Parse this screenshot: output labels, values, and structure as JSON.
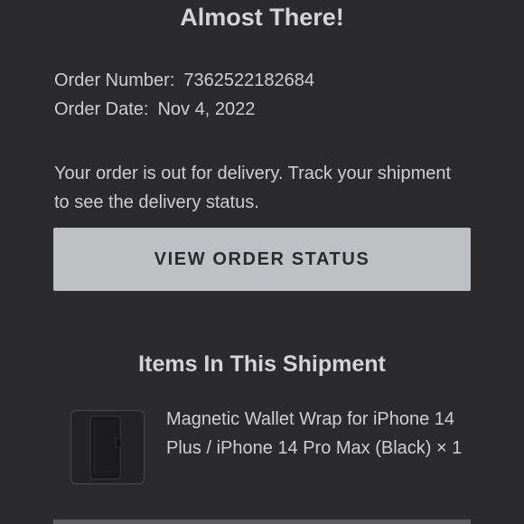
{
  "header": {
    "title": "Almost There!"
  },
  "order": {
    "number_label": "Order Number:",
    "number_value": "7362522182684",
    "date_label": "Order Date:",
    "date_value": "Nov 4, 2022"
  },
  "message": "Your order is out for delivery. Track your shipment to see the delivery status.",
  "actions": {
    "view_status_label": "VIEW ORDER STATUS"
  },
  "shipment": {
    "heading": "Items In This Shipment",
    "items": [
      {
        "description": "Magnetic Wallet Wrap for iPhone 14 Plus / iPhone 14 Pro Max (Black) × 1",
        "image_icon": "phone-wallet-case-icon"
      }
    ]
  },
  "colors": {
    "background": "#2b2b2e",
    "button": "#bfc0c3",
    "button_text": "#2a2a2c",
    "text": "#cfcfd1"
  }
}
